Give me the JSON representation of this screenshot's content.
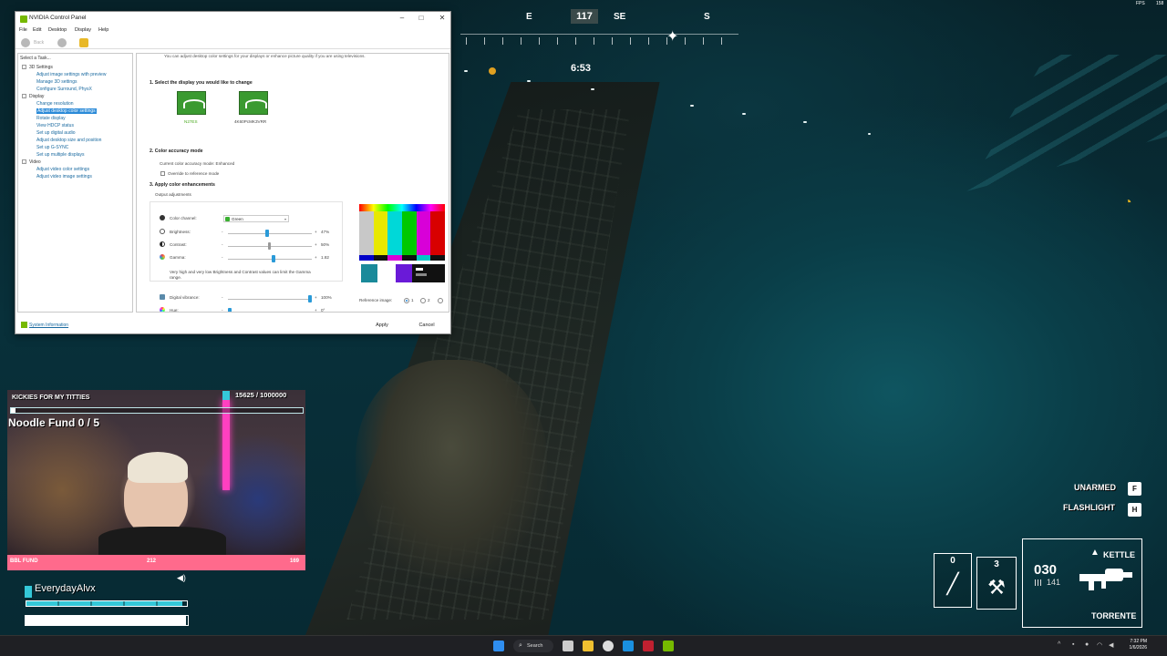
{
  "game_hud": {
    "compass": {
      "dirs": [
        "E",
        "SE",
        "S"
      ],
      "heading": "117"
    },
    "timer": "6:53",
    "fps_label": "FPS",
    "fps_value": "158",
    "prompts": [
      {
        "label": "UNARMED",
        "key": "F"
      },
      {
        "label": "FLASHLIGHT",
        "key": "H"
      }
    ],
    "slots": [
      {
        "count": "0",
        "icon": "knife-icon"
      },
      {
        "count": "3",
        "icon": "pickaxe-icon"
      }
    ],
    "weapon": {
      "name": "KETTLE",
      "ammo": "030",
      "reserve": "141",
      "subname": "TORRENTE"
    },
    "colors": {
      "accent": "#34c8d8",
      "warning": "#e0b020"
    }
  },
  "nvidia": {
    "title": "NVIDIA Control Panel",
    "menu": [
      "File",
      "Edit",
      "Desktop",
      "Display",
      "Help"
    ],
    "toolbar": {
      "back": "Back"
    },
    "task_label": "Select a Task...",
    "tree": [
      {
        "type": "cat",
        "label": "3D Settings"
      },
      {
        "type": "link",
        "label": "Adjust image settings with preview"
      },
      {
        "type": "link",
        "label": "Manage 3D settings"
      },
      {
        "type": "link",
        "label": "Configure Surround, PhysX"
      },
      {
        "type": "cat",
        "label": "Display"
      },
      {
        "type": "link",
        "label": "Change resolution"
      },
      {
        "type": "sel",
        "label": "Adjust desktop color settings"
      },
      {
        "type": "link",
        "label": "Rotate display"
      },
      {
        "type": "link",
        "label": "View HDCP status"
      },
      {
        "type": "link",
        "label": "Set up digital audio"
      },
      {
        "type": "link",
        "label": "Adjust desktop size and position"
      },
      {
        "type": "link",
        "label": "Set up G-SYNC"
      },
      {
        "type": "link",
        "label": "Set up multiple displays"
      },
      {
        "type": "cat",
        "label": "Video"
      },
      {
        "type": "link",
        "label": "Adjust video color settings"
      },
      {
        "type": "link",
        "label": "Adjust video image settings"
      }
    ],
    "intro": "You can adjust desktop color settings for your displays or enhance picture quality if you are using televisions.",
    "section1": "1. Select the display you would like to change",
    "displays": [
      "N27ES",
      "4K60PcMK3VRR"
    ],
    "section2": "2. Color accuracy mode",
    "accuracy_mode": "Current color accuracy mode: Enhanced",
    "override_label": "Override to reference mode",
    "section3": "3. Apply color enhancements",
    "output_adjustments": "Output adjustments",
    "color_channel_label": "Color channel:",
    "color_channel_value": "Green",
    "sliders": [
      {
        "label": "Brightness:",
        "value": "47%",
        "min_sym": "-",
        "max_sym": "+",
        "level": 0.47
      },
      {
        "label": "Contrast:",
        "value": "50%",
        "min_sym": "-",
        "max_sym": "+",
        "level": 0.5
      },
      {
        "label": "Gamma:",
        "value": "1.82",
        "min_sym": "-",
        "max_sym": "+",
        "level": 0.55
      }
    ],
    "warning": "Very high and very low Brightness and Contrast values can limit the Gamma range.",
    "vibrance": {
      "label": "Digital vibrance:",
      "value": "100%",
      "min_sym": "-",
      "max_sym": "+",
      "level": 1.0
    },
    "hue": {
      "label": "Hue:",
      "value": "0°",
      "min_sym": "-",
      "max_sym": "+",
      "level": 0.0
    },
    "reference_label": "Reference image:",
    "reference_options": [
      "1",
      "2"
    ],
    "system_info": "System Information",
    "apply": "Apply",
    "cancel": "Cancel"
  },
  "stream": {
    "title": "KICKIES FOR MY TITTIES",
    "goal": "15625 / 1000000",
    "goal_progress": 0.015625,
    "noodle_fund": "Noodle Fund 0 / 5",
    "bbl_label": "BBL FUND",
    "bbl_value": "212",
    "bbl_goal": "169",
    "username": "EverydayAlvx",
    "health_level": 0.97,
    "stamina_level": 0.99
  },
  "taskbar": {
    "search": "Search",
    "time": "7:32 PM",
    "date": "1/6/2026"
  }
}
